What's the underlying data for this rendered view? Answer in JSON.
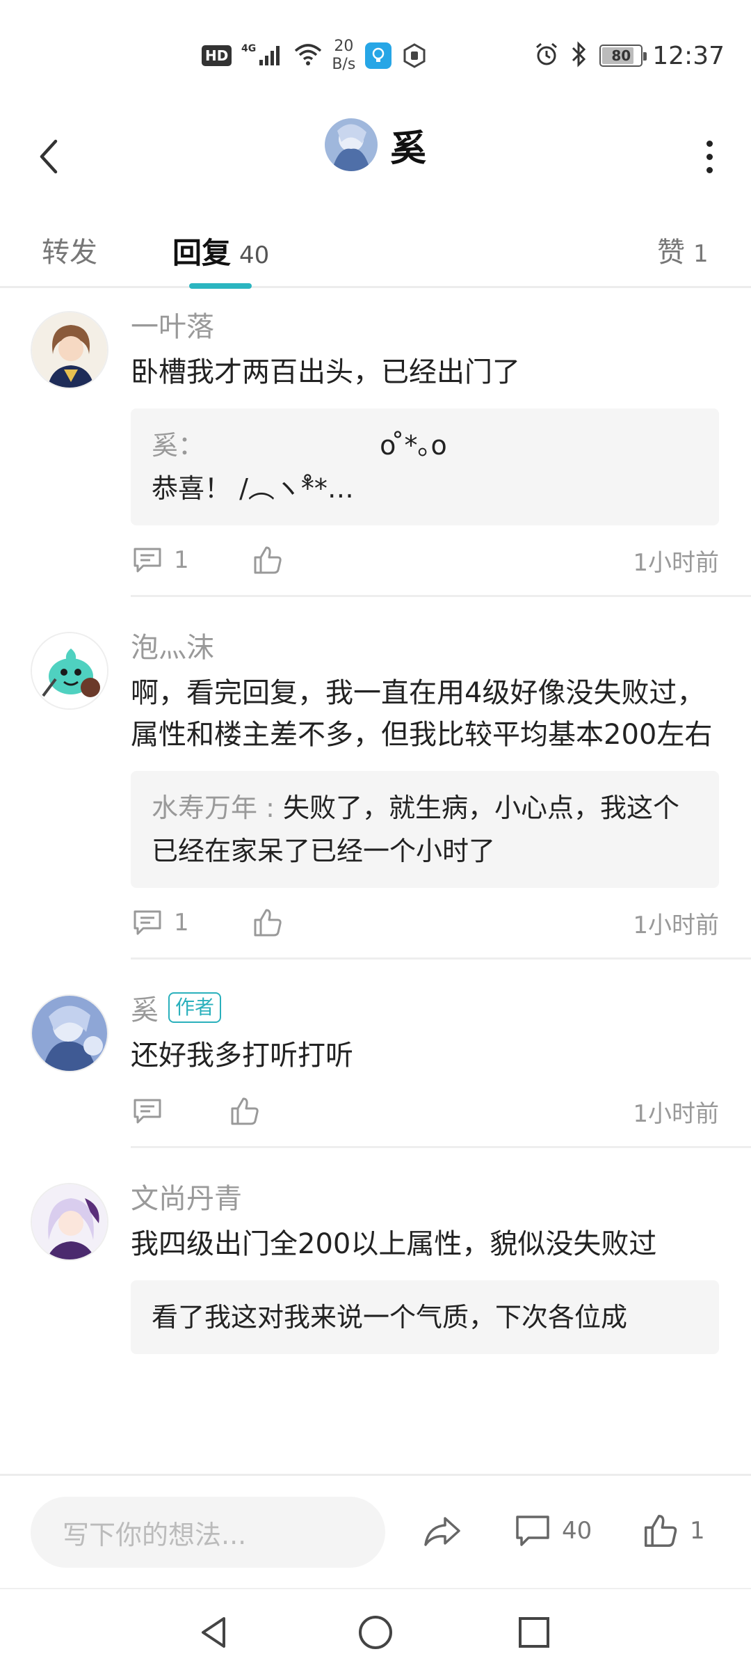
{
  "status_bar": {
    "hd": "HD",
    "net_speed_value": "20",
    "net_speed_unit": "B/s",
    "battery": "80",
    "battery_level": 0.8,
    "time": "12:37",
    "signal_label": "4G"
  },
  "header": {
    "title": "奚"
  },
  "tabs": [
    {
      "label": "转发",
      "count": ""
    },
    {
      "label": "回复",
      "count": "40"
    },
    {
      "label": "赞",
      "count": "1"
    }
  ],
  "comments": [
    {
      "username": "一叶落",
      "text": "卧槽我才两百出头，已经出门了",
      "quote_name": "奚：",
      "quote_lines": [
        "o ̊*｡o",
        "恭喜！    /︵ヽ*̊*…"
      ],
      "reply_count": "1",
      "like_count": "",
      "time": "1小时前"
    },
    {
      "username": "泡灬沫",
      "text": "啊，看完回复，我一直在用4级好像没失败过，属性和楼主差不多，但我比较平均基本200左右",
      "quote_name": "水寿万年 : ",
      "quote_text": "失败了，就生病，小心点，我这个已经在家呆了已经一个小时了",
      "reply_count": "1",
      "like_count": "",
      "time": "1小时前"
    },
    {
      "username": "奚",
      "badge": "作者",
      "text": "还好我多打听打听",
      "reply_count": "",
      "like_count": "",
      "time": "1小时前"
    },
    {
      "username": "文尚丹青",
      "text": "我四级出门全200以上属性，貌似没失败过",
      "quote_text": "看了我这对我来说一个气质，下次各位成"
    }
  ],
  "bottom_bar": {
    "input_placeholder": "写下你的想法...",
    "comment_count": "40",
    "like_count": "1"
  },
  "colors": {
    "accent": "#2bb5c0",
    "muted_text": "#999999",
    "quote_bg": "#f5f5f5"
  }
}
